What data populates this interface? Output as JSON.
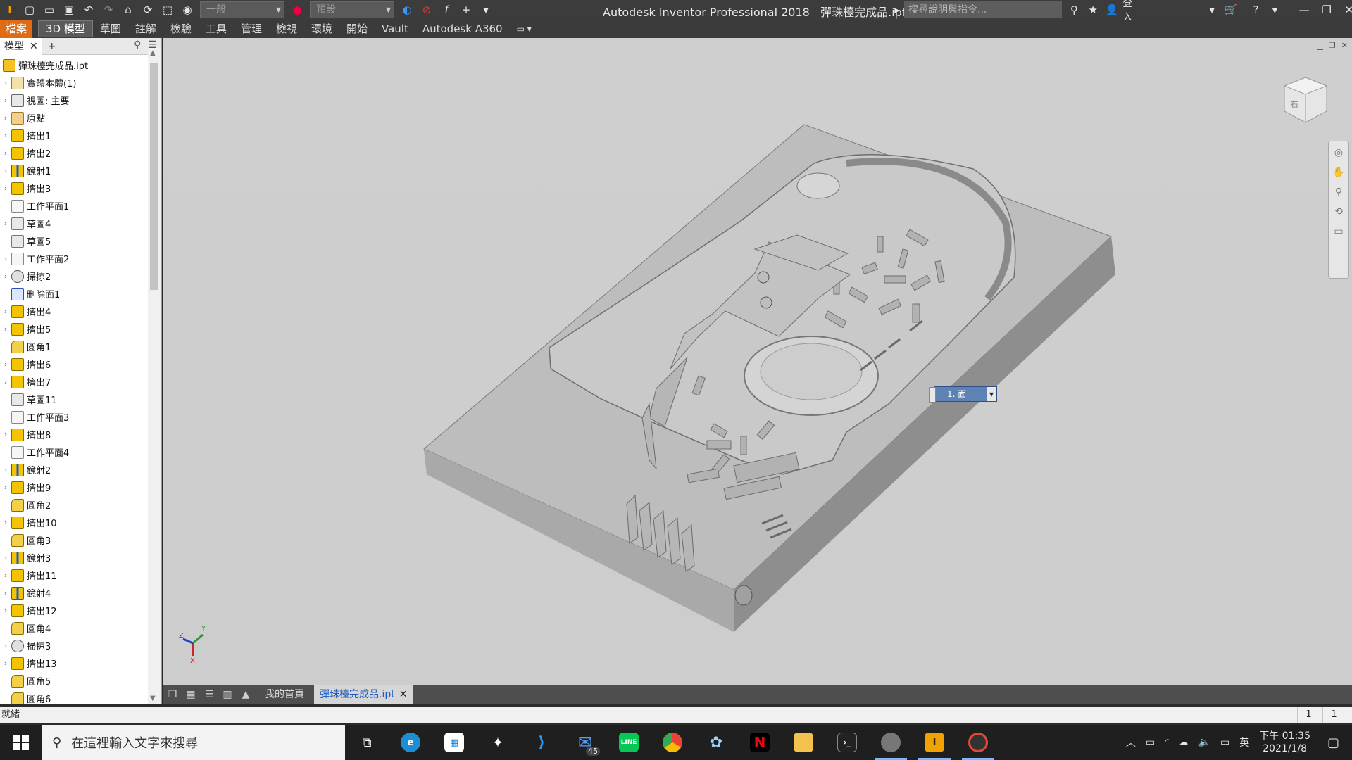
{
  "app": {
    "title": "Autodesk Inventor Professional 2018",
    "document": "彈珠檯完成品.ipt",
    "appearance_dropdown": "一般",
    "material_dropdown": "預設",
    "search_placeholder": "搜尋說明與指令...",
    "sign_in": "登入"
  },
  "ribbon": {
    "tabs": [
      "檔案",
      "3D 模型",
      "草圖",
      "註解",
      "檢驗",
      "工具",
      "管理",
      "檢視",
      "環境",
      "開始",
      "Vault",
      "Autodesk A360"
    ],
    "active": "3D 模型"
  },
  "browser": {
    "tab_label": "模型",
    "root": "彈珠檯完成品.ipt",
    "items": [
      {
        "label": "實體本體(1)",
        "icon": "solid-bodies-icon",
        "exp": true
      },
      {
        "label": "視圖: 主要",
        "icon": "view-icon",
        "exp": true
      },
      {
        "label": "原點",
        "icon": "origin-folder-icon",
        "exp": true
      },
      {
        "label": "擠出1",
        "icon": "extrude-icon",
        "exp": true
      },
      {
        "label": "擠出2",
        "icon": "extrude-icon",
        "exp": true
      },
      {
        "label": "鏡射1",
        "icon": "mirror-icon",
        "exp": true
      },
      {
        "label": "擠出3",
        "icon": "extrude-icon",
        "exp": true
      },
      {
        "label": "工作平面1",
        "icon": "work-plane-icon",
        "exp": false
      },
      {
        "label": "草圖4",
        "icon": "sketch-icon",
        "exp": true
      },
      {
        "label": "草圖5",
        "icon": "sketch-icon",
        "exp": false
      },
      {
        "label": "工作平面2",
        "icon": "work-plane-icon",
        "exp": true
      },
      {
        "label": "掃掠2",
        "icon": "sweep-icon",
        "exp": true
      },
      {
        "label": "刪除面1",
        "icon": "delete-face-icon",
        "exp": false
      },
      {
        "label": "擠出4",
        "icon": "extrude-icon",
        "exp": true
      },
      {
        "label": "擠出5",
        "icon": "extrude-icon",
        "exp": true
      },
      {
        "label": "圓角1",
        "icon": "fillet-icon",
        "exp": false
      },
      {
        "label": "擠出6",
        "icon": "extrude-icon",
        "exp": true
      },
      {
        "label": "擠出7",
        "icon": "extrude-icon",
        "exp": true
      },
      {
        "label": "草圖11",
        "icon": "sketch-icon",
        "exp": false
      },
      {
        "label": "工作平面3",
        "icon": "work-plane-icon",
        "exp": false
      },
      {
        "label": "擠出8",
        "icon": "extrude-icon",
        "exp": true
      },
      {
        "label": "工作平面4",
        "icon": "work-plane-icon",
        "exp": false
      },
      {
        "label": "鏡射2",
        "icon": "mirror-icon",
        "exp": true
      },
      {
        "label": "擠出9",
        "icon": "extrude-icon",
        "exp": true
      },
      {
        "label": "圓角2",
        "icon": "fillet-icon",
        "exp": false
      },
      {
        "label": "擠出10",
        "icon": "extrude-icon",
        "exp": true
      },
      {
        "label": "圓角3",
        "icon": "fillet-icon",
        "exp": false
      },
      {
        "label": "鏡射3",
        "icon": "mirror-icon",
        "exp": true
      },
      {
        "label": "擠出11",
        "icon": "extrude-icon",
        "exp": true
      },
      {
        "label": "鏡射4",
        "icon": "mirror-icon",
        "exp": true
      },
      {
        "label": "擠出12",
        "icon": "extrude-icon",
        "exp": true
      },
      {
        "label": "圓角4",
        "icon": "fillet-icon",
        "exp": false
      },
      {
        "label": "掃掠3",
        "icon": "sweep-icon",
        "exp": true
      },
      {
        "label": "擠出13",
        "icon": "extrude-icon",
        "exp": true
      },
      {
        "label": "圓角5",
        "icon": "fillet-icon",
        "exp": false
      },
      {
        "label": "圓角6",
        "icon": "fillet-icon",
        "exp": false
      }
    ]
  },
  "viewport": {
    "face_selector": "1. 面",
    "axes": [
      "X",
      "Y",
      "Z"
    ]
  },
  "doc_tabs": {
    "home": "我的首頁",
    "active": "彈珠檯完成品.ipt"
  },
  "status": {
    "text": "就緒",
    "count1": "1",
    "count2": "1"
  },
  "taskbar": {
    "search_placeholder": "在這裡輸入文字來搜尋",
    "mail_badge": "45",
    "clock_time": "下午 01:35",
    "clock_date": "2021/1/8",
    "ime": "英"
  },
  "colors": {
    "accent_file": "#e06b16",
    "viewport_bg": "#cdcdcd",
    "selection_blue": "#5f82b5"
  }
}
